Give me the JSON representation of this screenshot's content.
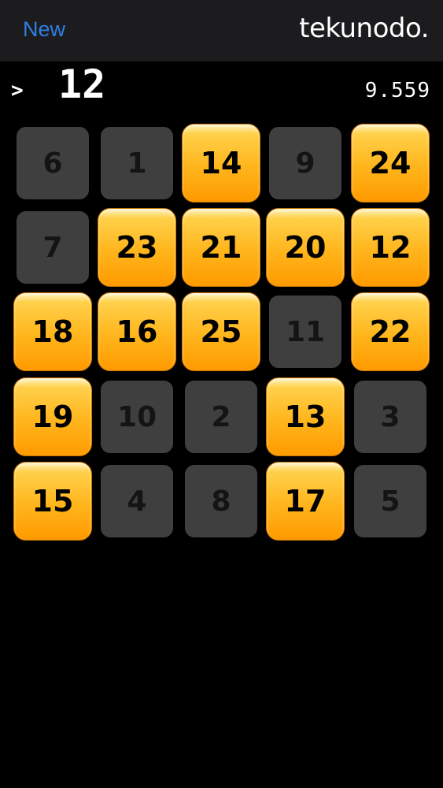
{
  "header": {
    "new_label": "New",
    "brand": "tekunodo."
  },
  "status": {
    "prompt": ">",
    "target": "12",
    "timer": "9.559"
  },
  "grid": {
    "rows": [
      [
        {
          "n": "6",
          "lit": false
        },
        {
          "n": "1",
          "lit": false
        },
        {
          "n": "14",
          "lit": true
        },
        {
          "n": "9",
          "lit": false
        },
        {
          "n": "24",
          "lit": true
        }
      ],
      [
        {
          "n": "7",
          "lit": false
        },
        {
          "n": "23",
          "lit": true
        },
        {
          "n": "21",
          "lit": true
        },
        {
          "n": "20",
          "lit": true
        },
        {
          "n": "12",
          "lit": true
        }
      ],
      [
        {
          "n": "18",
          "lit": true
        },
        {
          "n": "16",
          "lit": true
        },
        {
          "n": "25",
          "lit": true
        },
        {
          "n": "11",
          "lit": false
        },
        {
          "n": "22",
          "lit": true
        }
      ],
      [
        {
          "n": "19",
          "lit": true
        },
        {
          "n": "10",
          "lit": false
        },
        {
          "n": "2",
          "lit": false
        },
        {
          "n": "13",
          "lit": true
        },
        {
          "n": "3",
          "lit": false
        }
      ],
      [
        {
          "n": "15",
          "lit": true
        },
        {
          "n": "4",
          "lit": false
        },
        {
          "n": "8",
          "lit": false
        },
        {
          "n": "17",
          "lit": true
        },
        {
          "n": "5",
          "lit": false
        }
      ]
    ]
  },
  "colors": {
    "accent": "#2f7fe6",
    "tile_lit": "#ffb51c",
    "tile_dark": "#3f3f3f",
    "background": "#000000",
    "navbar": "#1c1c1e"
  }
}
